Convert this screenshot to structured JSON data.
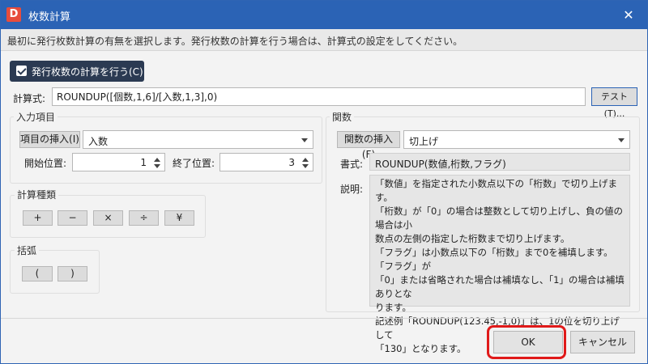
{
  "window": {
    "title": "枚数計算",
    "app_icon": "D",
    "close_symbol": "✕"
  },
  "info": {
    "text": "最初に発行枚数計算の有無を選択します。発行枚数の計算を行う場合は、計算式の設定をしてください。"
  },
  "toggle": {
    "label": "発行枚数の計算を行う(C)",
    "checked": true
  },
  "formula": {
    "label": "計算式:",
    "value": "ROUNDUP([個数,1,6]/[入数,1,3],0)",
    "test_button": "テスト(T)..."
  },
  "input_items": {
    "title": "入力項目",
    "insert_button": "項目の挿入(I)",
    "selected_item": "入数",
    "start_label": "開始位置:",
    "start_value": "1",
    "end_label": "終了位置:",
    "end_value": "3"
  },
  "calc_types": {
    "title": "計算種類",
    "operators": [
      "+",
      "−",
      "×",
      "÷",
      "¥"
    ]
  },
  "brackets": {
    "title": "括弧",
    "items": [
      "(",
      ")"
    ]
  },
  "functions": {
    "title": "関数",
    "insert_button": "関数の挿入(F)",
    "selected_function": "切上げ",
    "format_label": "書式:",
    "format_value": "ROUNDUP(数値,桁数,フラグ)",
    "desc_label": "説明:",
    "description_lines": [
      "「数値」を指定された小数点以下の「桁数」で切り上げます。",
      "「桁数」が「0」の場合は整数として切り上げし、負の値の場合は小",
      "数点の左側の指定した桁数まで切り上げます。",
      "「フラグ」は小数点以下の「桁数」まで0を補填します。「フラグ」が",
      "「0」または省略された場合は補填なし、「1」の場合は補填ありとな",
      "ります。",
      "記述例「ROUNDUP(123.45,-1,0)」は、1の位を切り上げして",
      "「130」となります。"
    ]
  },
  "footer": {
    "ok": "OK",
    "cancel": "キャンセル"
  },
  "colors": {
    "titlebar": "#2b63b5",
    "toggle_bg": "#2b3a52",
    "highlight": "#e01a1a"
  }
}
